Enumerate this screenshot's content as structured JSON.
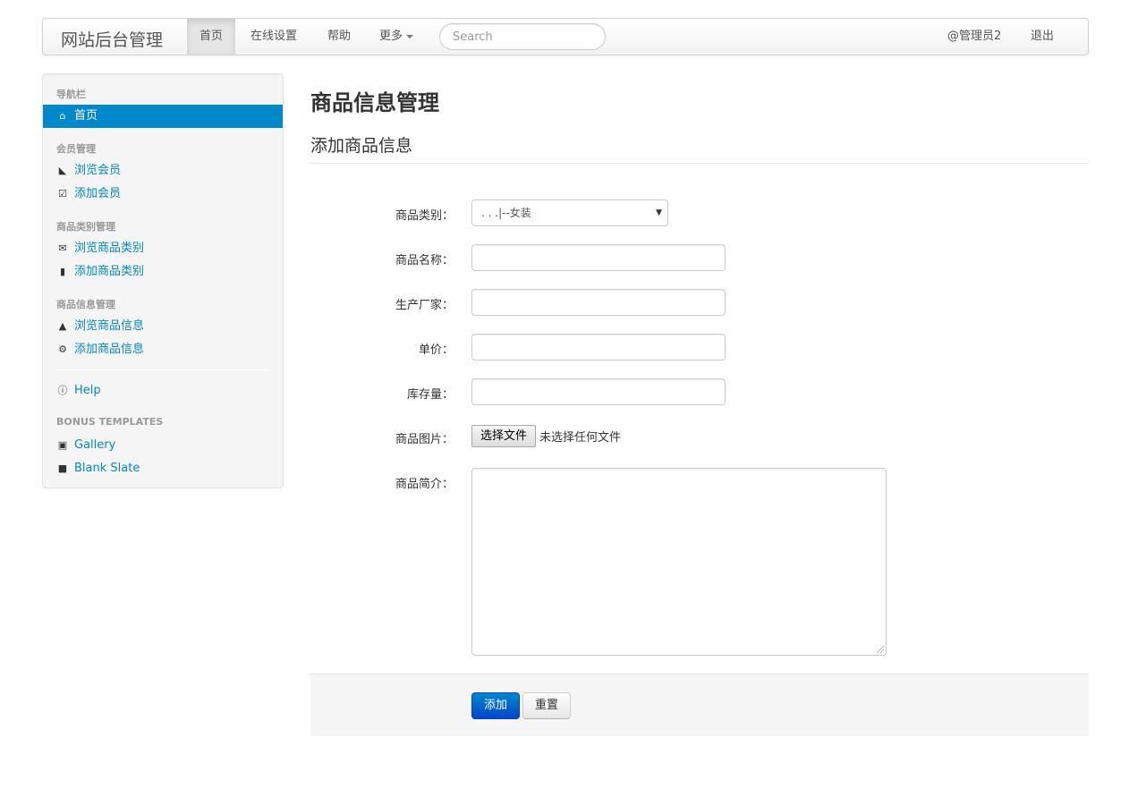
{
  "navbar": {
    "brand": "网站后台管理",
    "items": [
      {
        "label": "首页",
        "active": true
      },
      {
        "label": "在线设置",
        "active": false
      },
      {
        "label": "帮助",
        "active": false
      },
      {
        "label": "更多",
        "active": false
      }
    ],
    "search_placeholder": "Search",
    "user": "@管理员2",
    "logout": "退出"
  },
  "sidebar": {
    "sections": [
      {
        "header": "导航栏",
        "items": [
          {
            "label": "首页",
            "icon": "home-icon",
            "active": true
          }
        ]
      },
      {
        "header": "会员管理",
        "items": [
          {
            "label": "浏览会员",
            "icon": "folder-open-icon"
          },
          {
            "label": "添加会员",
            "icon": "check-icon"
          }
        ]
      },
      {
        "header": "商品类别管理",
        "items": [
          {
            "label": "浏览商品类别",
            "icon": "envelope-icon"
          },
          {
            "label": "添加商品类别",
            "icon": "file-icon"
          }
        ]
      },
      {
        "header": "商品信息管理",
        "items": [
          {
            "label": "浏览商品信息",
            "icon": "user-icon"
          },
          {
            "label": "添加商品信息",
            "icon": "cog-icon"
          }
        ]
      }
    ],
    "help": {
      "label": "Help",
      "icon": "info-sign-icon"
    },
    "bonus": {
      "header": "BONUS TEMPLATES",
      "items": [
        {
          "label": "Gallery",
          "icon": "picture-icon"
        },
        {
          "label": "Blank Slate",
          "icon": "stop-icon"
        }
      ]
    }
  },
  "main": {
    "title": "商品信息管理",
    "legend": "添加商品信息",
    "form": {
      "category_label": "商品类别：",
      "category_value": ". . .|--女装",
      "name_label": "商品名称：",
      "name_value": "",
      "maker_label": "生产厂家：",
      "maker_value": "",
      "price_label": "单价：",
      "price_value": "",
      "stock_label": "库存量：",
      "stock_value": "",
      "image_label": "商品图片：",
      "file_button": "选择文件",
      "file_status": "未选择任何文件",
      "desc_label": "商品简介：",
      "desc_value": ""
    },
    "actions": {
      "submit": "添加",
      "reset": "重置"
    }
  },
  "colors": {
    "accent": "#0088cc",
    "primary_button": "#0055cc"
  }
}
